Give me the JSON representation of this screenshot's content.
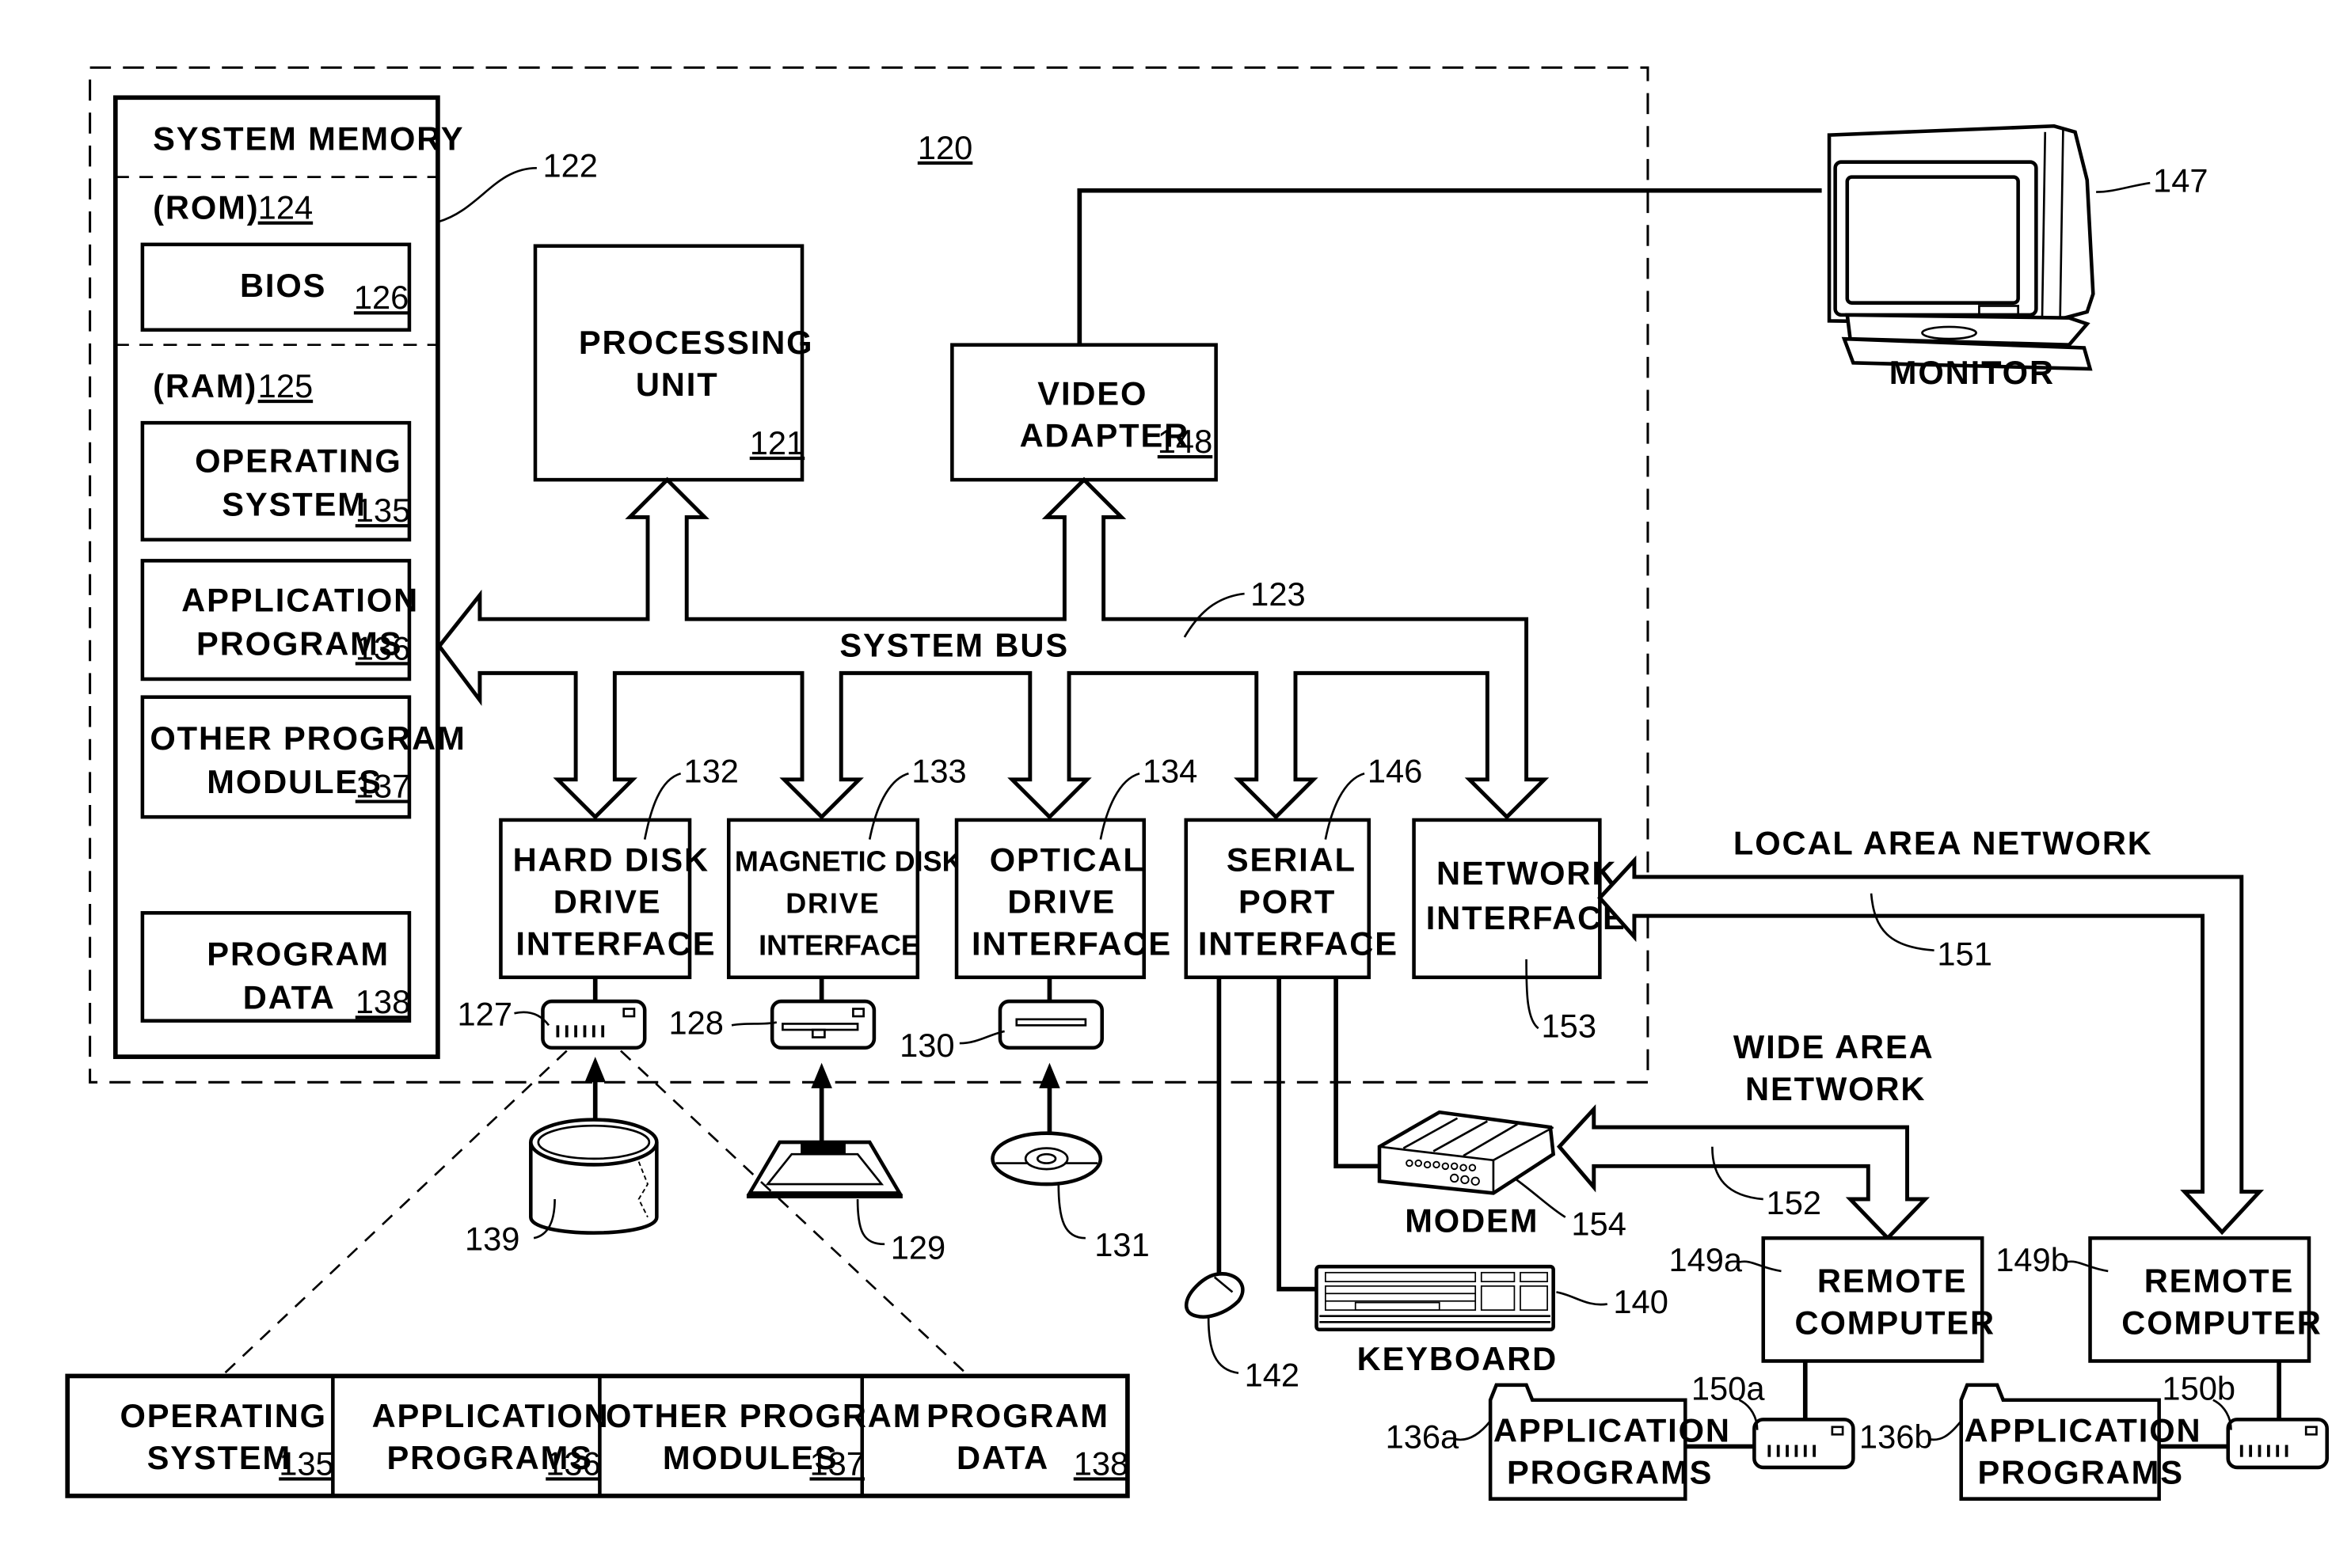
{
  "figure": {
    "computer_ref": "120",
    "system_memory": {
      "title": "SYSTEM MEMORY",
      "ref": "122",
      "rom_label": "(ROM)",
      "rom_ref": "124",
      "bios_label": "BIOS",
      "bios_ref": "126",
      "ram_label": "(RAM)",
      "ram_ref": "125",
      "modules": [
        {
          "line1": "OPERATING",
          "line2": "SYSTEM",
          "ref": "135"
        },
        {
          "line1": "APPLICATION",
          "line2": "PROGRAMS",
          "ref": "136"
        },
        {
          "line1": "OTHER PROGRAM",
          "line2": "MODULES",
          "ref": "137"
        },
        {
          "line1": "PROGRAM",
          "line2": "DATA",
          "ref": "138"
        }
      ]
    },
    "processing_unit": {
      "line1": "PROCESSING",
      "line2": "UNIT",
      "ref": "121"
    },
    "video_adapter": {
      "line1": "VIDEO",
      "line2": "ADAPTER",
      "ref": "148"
    },
    "system_bus": {
      "label": "SYSTEM BUS",
      "ref": "123"
    },
    "interfaces": [
      {
        "line1": "HARD DISK",
        "line2": "DRIVE",
        "line3": "INTERFACE",
        "ref": "132"
      },
      {
        "line1": "MAGNETIC DISK",
        "line2": "DRIVE",
        "line3": "INTERFACE",
        "ref": "133"
      },
      {
        "line1": "OPTICAL",
        "line2": "DRIVE",
        "line3": "INTERFACE",
        "ref": "134"
      },
      {
        "line1": "SERIAL",
        "line2": "PORT",
        "line3": "INTERFACE",
        "ref": "146"
      },
      {
        "line1": "NETWORK",
        "line2": "INTERFACE",
        "line3": "",
        "ref": "153"
      }
    ],
    "drives": {
      "hard_disk_ref": "127",
      "magnetic_disk_ref": "128",
      "optical_ref": "130"
    },
    "media": {
      "hard_disk_media_ref": "139",
      "floppy_ref": "129",
      "optical_disc_ref": "131"
    },
    "monitor": {
      "label": "MONITOR",
      "ref": "147"
    },
    "peripherals": {
      "modem_label": "MODEM",
      "modem_ref": "154",
      "keyboard_label": "KEYBOARD",
      "keyboard_ref": "140",
      "mouse_ref": "142"
    },
    "networks": {
      "lan_label": "LOCAL AREA NETWORK",
      "lan_ref": "151",
      "wan_line1": "WIDE AREA",
      "wan_line2": "NETWORK",
      "wan_ref": "152"
    },
    "remote_computers": [
      {
        "line1": "REMOTE",
        "line2": "COMPUTER",
        "ref": "149a",
        "drive_ref": "150a",
        "apps_line1": "APPLICATION",
        "apps_line2": "PROGRAMS",
        "apps_ref": "136a"
      },
      {
        "line1": "REMOTE",
        "line2": "COMPUTER",
        "ref": "149b",
        "drive_ref": "150b",
        "apps_line1": "APPLICATION",
        "apps_line2": "PROGRAMS",
        "apps_ref": "136b"
      }
    ],
    "hard_disk_contents": [
      {
        "line1": "OPERATING",
        "line2": "SYSTEM",
        "ref": "135"
      },
      {
        "line1": "APPLICATION",
        "line2": "PROGRAMS",
        "ref": "136"
      },
      {
        "line1": "OTHER PROGRAM",
        "line2": "MODULES",
        "ref": "137"
      },
      {
        "line1": "PROGRAM",
        "line2": "DATA",
        "ref": "138"
      }
    ]
  }
}
